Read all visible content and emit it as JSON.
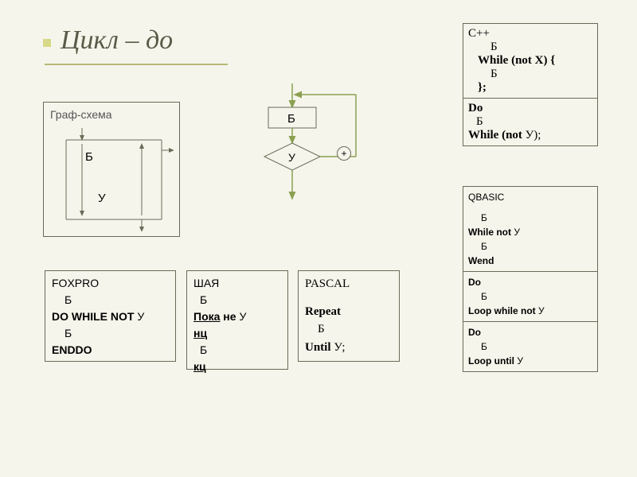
{
  "title": "Цикл – до",
  "graf": {
    "label": "Граф-схема",
    "b": "Б",
    "u": "У"
  },
  "flow": {
    "b": "Б",
    "u": "У",
    "plus": "+"
  },
  "foxpro": {
    "name": "FOXPRO",
    "l1": "Б",
    "l2a": "DO WHILE  NOT ",
    "l2b": "У",
    "l3": "Б",
    "l4": "ENDDO"
  },
  "shaya": {
    "name": "ШАЯ",
    "l1": "Б",
    "l2a": "Пока",
    "l2b": "  не ",
    "l2c": "У",
    "l3": "нц",
    "l4": "Б",
    "l5": "кц"
  },
  "pascal": {
    "name": "PASCAL",
    "l1": "Repeat",
    "l2": "Б",
    "l3a": "Until ",
    "l3b": "У;"
  },
  "cpp": {
    "name": "C++",
    "c1_l1": "Б",
    "c1_l2": "While (not X) {",
    "c1_l3": "Б",
    "c1_l4": "};",
    "c2_l1": "Do",
    "c2_l2": "Б",
    "c2_l3a": "While (not ",
    "c2_l3b": "У);"
  },
  "qbasic": {
    "name": "QBASIC",
    "c1_l1": "Б",
    "c1_l2a": "While not ",
    "c1_l2b": "У",
    "c1_l3": "Б",
    "c1_l4": "Wend",
    "c2_l1": "Do",
    "c2_l2": "Б",
    "c2_l3a": "Loop while not  ",
    "c2_l3b": "У",
    "c3_l1": "Do",
    "c3_l2": "Б",
    "c3_l3a": "Loop until  ",
    "c3_l3b": "У"
  }
}
